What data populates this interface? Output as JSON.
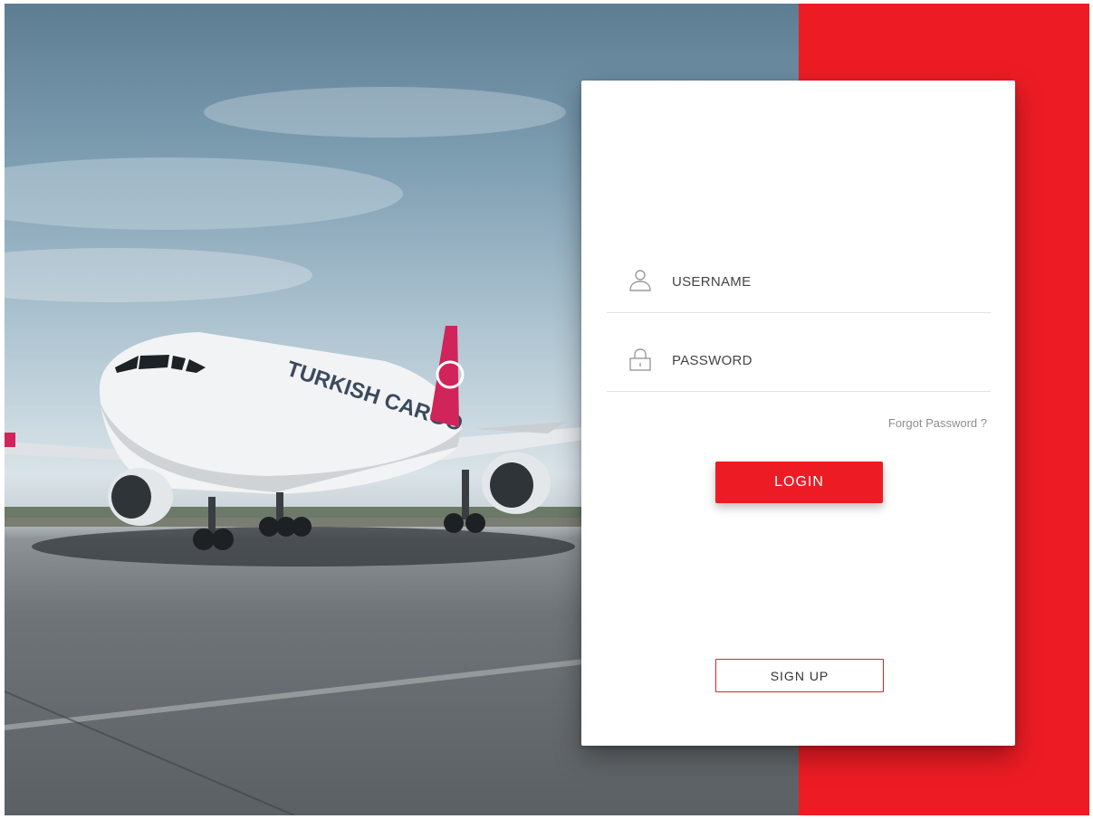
{
  "login_form": {
    "username_label": "USERNAME",
    "password_label": "PASSWORD",
    "forgot_password": "Forgot Password ?",
    "login_button": "LOGIN",
    "signup_button": "SIGN UP"
  },
  "hero_image": {
    "livery_text": "TURKISH CARGO"
  },
  "colors": {
    "accent_red": "#ed1c24",
    "card_bg": "#ffffff",
    "label_text": "#444444",
    "muted_text": "#8d8d8d"
  },
  "icons": {
    "username": "user-icon",
    "password": "lock-icon"
  }
}
